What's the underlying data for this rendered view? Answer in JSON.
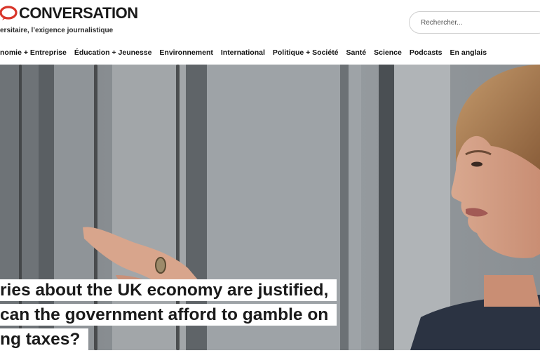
{
  "brand": {
    "name": "CONVERSATION",
    "tagline": "ersitaire, l’exigence journalistique",
    "accent_color": "#d8352a"
  },
  "search": {
    "placeholder": "Rechercher..."
  },
  "nav": {
    "items": [
      {
        "label": "nomie + Entreprise"
      },
      {
        "label": "Éducation + Jeunesse"
      },
      {
        "label": "Environnement"
      },
      {
        "label": "International"
      },
      {
        "label": "Politique + Société"
      },
      {
        "label": "Santé"
      },
      {
        "label": "Science"
      },
      {
        "label": "Podcasts"
      },
      {
        "label": "En anglais"
      }
    ]
  },
  "article": {
    "headline_lines": [
      "ries about the UK economy are justified,",
      "can the government afford to gamble on",
      "ng taxes?"
    ]
  }
}
